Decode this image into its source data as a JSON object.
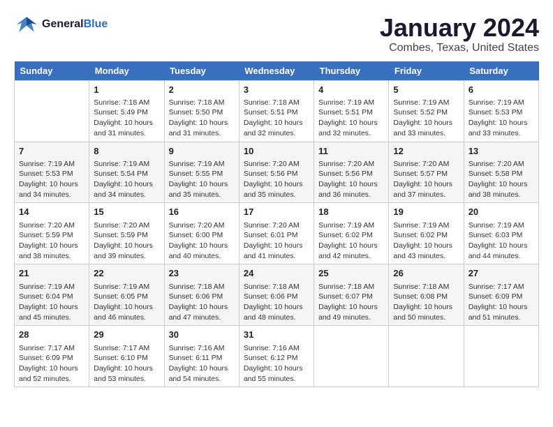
{
  "logo": {
    "line1": "General",
    "line2": "Blue"
  },
  "title": "January 2024",
  "subtitle": "Combes, Texas, United States",
  "header_color": "#3a6ebf",
  "days_of_week": [
    "Sunday",
    "Monday",
    "Tuesday",
    "Wednesday",
    "Thursday",
    "Friday",
    "Saturday"
  ],
  "weeks": [
    [
      {
        "day": "",
        "info": ""
      },
      {
        "day": "1",
        "info": "Sunrise: 7:18 AM\nSunset: 5:49 PM\nDaylight: 10 hours\nand 31 minutes."
      },
      {
        "day": "2",
        "info": "Sunrise: 7:18 AM\nSunset: 5:50 PM\nDaylight: 10 hours\nand 31 minutes."
      },
      {
        "day": "3",
        "info": "Sunrise: 7:18 AM\nSunset: 5:51 PM\nDaylight: 10 hours\nand 32 minutes."
      },
      {
        "day": "4",
        "info": "Sunrise: 7:19 AM\nSunset: 5:51 PM\nDaylight: 10 hours\nand 32 minutes."
      },
      {
        "day": "5",
        "info": "Sunrise: 7:19 AM\nSunset: 5:52 PM\nDaylight: 10 hours\nand 33 minutes."
      },
      {
        "day": "6",
        "info": "Sunrise: 7:19 AM\nSunset: 5:53 PM\nDaylight: 10 hours\nand 33 minutes."
      }
    ],
    [
      {
        "day": "7",
        "info": "Sunrise: 7:19 AM\nSunset: 5:53 PM\nDaylight: 10 hours\nand 34 minutes."
      },
      {
        "day": "8",
        "info": "Sunrise: 7:19 AM\nSunset: 5:54 PM\nDaylight: 10 hours\nand 34 minutes."
      },
      {
        "day": "9",
        "info": "Sunrise: 7:19 AM\nSunset: 5:55 PM\nDaylight: 10 hours\nand 35 minutes."
      },
      {
        "day": "10",
        "info": "Sunrise: 7:20 AM\nSunset: 5:56 PM\nDaylight: 10 hours\nand 35 minutes."
      },
      {
        "day": "11",
        "info": "Sunrise: 7:20 AM\nSunset: 5:56 PM\nDaylight: 10 hours\nand 36 minutes."
      },
      {
        "day": "12",
        "info": "Sunrise: 7:20 AM\nSunset: 5:57 PM\nDaylight: 10 hours\nand 37 minutes."
      },
      {
        "day": "13",
        "info": "Sunrise: 7:20 AM\nSunset: 5:58 PM\nDaylight: 10 hours\nand 38 minutes."
      }
    ],
    [
      {
        "day": "14",
        "info": "Sunrise: 7:20 AM\nSunset: 5:59 PM\nDaylight: 10 hours\nand 38 minutes."
      },
      {
        "day": "15",
        "info": "Sunrise: 7:20 AM\nSunset: 5:59 PM\nDaylight: 10 hours\nand 39 minutes."
      },
      {
        "day": "16",
        "info": "Sunrise: 7:20 AM\nSunset: 6:00 PM\nDaylight: 10 hours\nand 40 minutes."
      },
      {
        "day": "17",
        "info": "Sunrise: 7:20 AM\nSunset: 6:01 PM\nDaylight: 10 hours\nand 41 minutes."
      },
      {
        "day": "18",
        "info": "Sunrise: 7:19 AM\nSunset: 6:02 PM\nDaylight: 10 hours\nand 42 minutes."
      },
      {
        "day": "19",
        "info": "Sunrise: 7:19 AM\nSunset: 6:02 PM\nDaylight: 10 hours\nand 43 minutes."
      },
      {
        "day": "20",
        "info": "Sunrise: 7:19 AM\nSunset: 6:03 PM\nDaylight: 10 hours\nand 44 minutes."
      }
    ],
    [
      {
        "day": "21",
        "info": "Sunrise: 7:19 AM\nSunset: 6:04 PM\nDaylight: 10 hours\nand 45 minutes."
      },
      {
        "day": "22",
        "info": "Sunrise: 7:19 AM\nSunset: 6:05 PM\nDaylight: 10 hours\nand 46 minutes."
      },
      {
        "day": "23",
        "info": "Sunrise: 7:18 AM\nSunset: 6:06 PM\nDaylight: 10 hours\nand 47 minutes."
      },
      {
        "day": "24",
        "info": "Sunrise: 7:18 AM\nSunset: 6:06 PM\nDaylight: 10 hours\nand 48 minutes."
      },
      {
        "day": "25",
        "info": "Sunrise: 7:18 AM\nSunset: 6:07 PM\nDaylight: 10 hours\nand 49 minutes."
      },
      {
        "day": "26",
        "info": "Sunrise: 7:18 AM\nSunset: 6:08 PM\nDaylight: 10 hours\nand 50 minutes."
      },
      {
        "day": "27",
        "info": "Sunrise: 7:17 AM\nSunset: 6:09 PM\nDaylight: 10 hours\nand 51 minutes."
      }
    ],
    [
      {
        "day": "28",
        "info": "Sunrise: 7:17 AM\nSunset: 6:09 PM\nDaylight: 10 hours\nand 52 minutes."
      },
      {
        "day": "29",
        "info": "Sunrise: 7:17 AM\nSunset: 6:10 PM\nDaylight: 10 hours\nand 53 minutes."
      },
      {
        "day": "30",
        "info": "Sunrise: 7:16 AM\nSunset: 6:11 PM\nDaylight: 10 hours\nand 54 minutes."
      },
      {
        "day": "31",
        "info": "Sunrise: 7:16 AM\nSunset: 6:12 PM\nDaylight: 10 hours\nand 55 minutes."
      },
      {
        "day": "",
        "info": ""
      },
      {
        "day": "",
        "info": ""
      },
      {
        "day": "",
        "info": ""
      }
    ]
  ]
}
